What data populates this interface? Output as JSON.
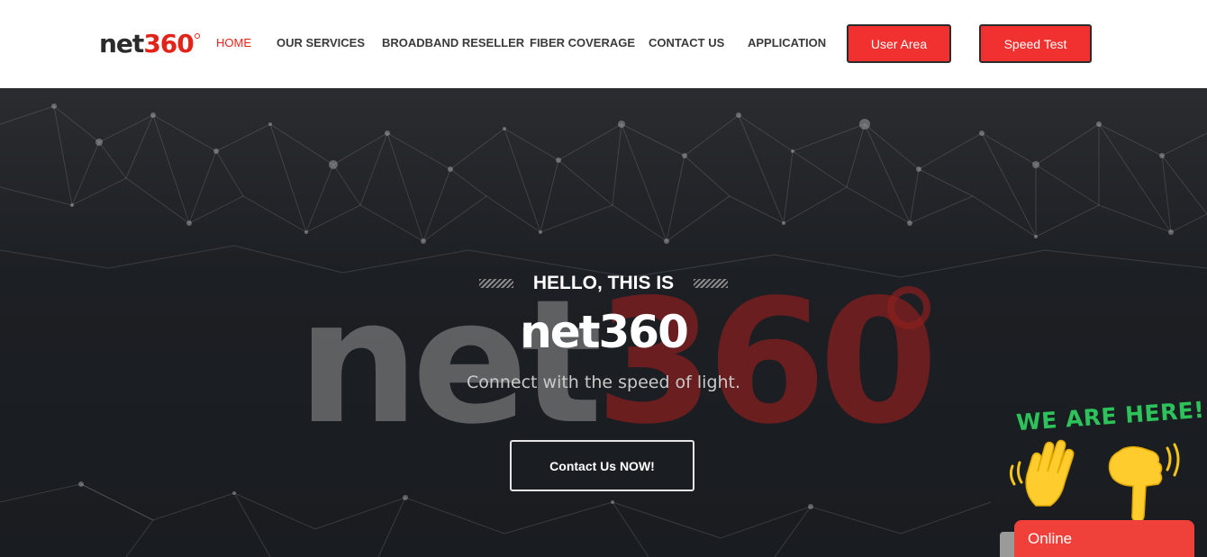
{
  "header": {
    "logo": {
      "part1": "net",
      "part2": "360"
    },
    "nav": [
      "HOME",
      "OUR SERVICES",
      "BROADBAND RESELLER",
      "FIBER COVERAGE",
      "CONTACT US",
      "APPLICATION"
    ],
    "user_area_label": "User Area",
    "speed_test_label": "Speed Test"
  },
  "hero": {
    "intro": "HELLO, THIS IS",
    "title": "net360",
    "subtitle": "Connect with the speed of light.",
    "cta_label": "Contact Us NOW!",
    "background_logo": {
      "part1": "net",
      "part2": "360"
    }
  },
  "chat_widget": {
    "banner": "WE ARE HERE!",
    "status": "Online",
    "icons": [
      "waving-hand-icon",
      "pointing-down-icon"
    ]
  },
  "colors": {
    "accent": "#f0312f",
    "active_nav": "#e2231a",
    "hero_bg": "#1a1d21",
    "banner_green": "#2ec25a"
  }
}
